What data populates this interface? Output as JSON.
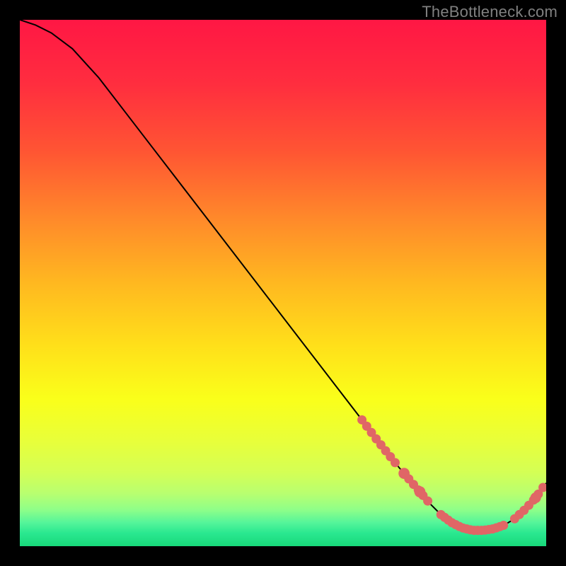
{
  "watermark": "TheBottleneck.com",
  "chart_data": {
    "type": "line",
    "title": "",
    "xlabel": "",
    "ylabel": "",
    "xlim": [
      0,
      100
    ],
    "ylim": [
      0,
      100
    ],
    "x": [
      0,
      3,
      6,
      10,
      15,
      20,
      25,
      30,
      35,
      40,
      45,
      50,
      55,
      60,
      65,
      68,
      72,
      75,
      78,
      80,
      82,
      84,
      86,
      88,
      90,
      92,
      94,
      96,
      98,
      100
    ],
    "y": [
      100,
      99,
      97.5,
      94.5,
      89,
      82.5,
      76,
      69.5,
      63,
      56.5,
      50,
      43.5,
      37,
      30.5,
      24,
      20,
      15,
      11.5,
      8,
      6,
      4.5,
      3.5,
      3,
      3,
      3.3,
      4,
      5.2,
      7,
      9.2,
      12
    ],
    "highlight_clusters": [
      {
        "x_start": 65,
        "x_end": 72,
        "desc": "descent cluster upper"
      },
      {
        "x_start": 73,
        "x_end": 78,
        "desc": "descent cluster lower"
      },
      {
        "x_start": 80,
        "x_end": 92,
        "desc": "valley floor cluster"
      },
      {
        "x_start": 94,
        "x_end": 100,
        "desc": "rising tail cluster"
      }
    ],
    "gradient_stops": [
      {
        "offset": 0.0,
        "color": "#ff1744"
      },
      {
        "offset": 0.12,
        "color": "#ff2d3f"
      },
      {
        "offset": 0.25,
        "color": "#ff5533"
      },
      {
        "offset": 0.38,
        "color": "#ff8a2a"
      },
      {
        "offset": 0.5,
        "color": "#ffb820"
      },
      {
        "offset": 0.62,
        "color": "#ffe01a"
      },
      {
        "offset": 0.72,
        "color": "#faff1a"
      },
      {
        "offset": 0.8,
        "color": "#e8ff3a"
      },
      {
        "offset": 0.86,
        "color": "#d4ff55"
      },
      {
        "offset": 0.9,
        "color": "#b8ff70"
      },
      {
        "offset": 0.93,
        "color": "#90ff88"
      },
      {
        "offset": 0.955,
        "color": "#55f59a"
      },
      {
        "offset": 0.975,
        "color": "#2ae890"
      },
      {
        "offset": 1.0,
        "color": "#18d97a"
      }
    ],
    "curve_color": "#000000",
    "marker_color": "#e06666"
  }
}
